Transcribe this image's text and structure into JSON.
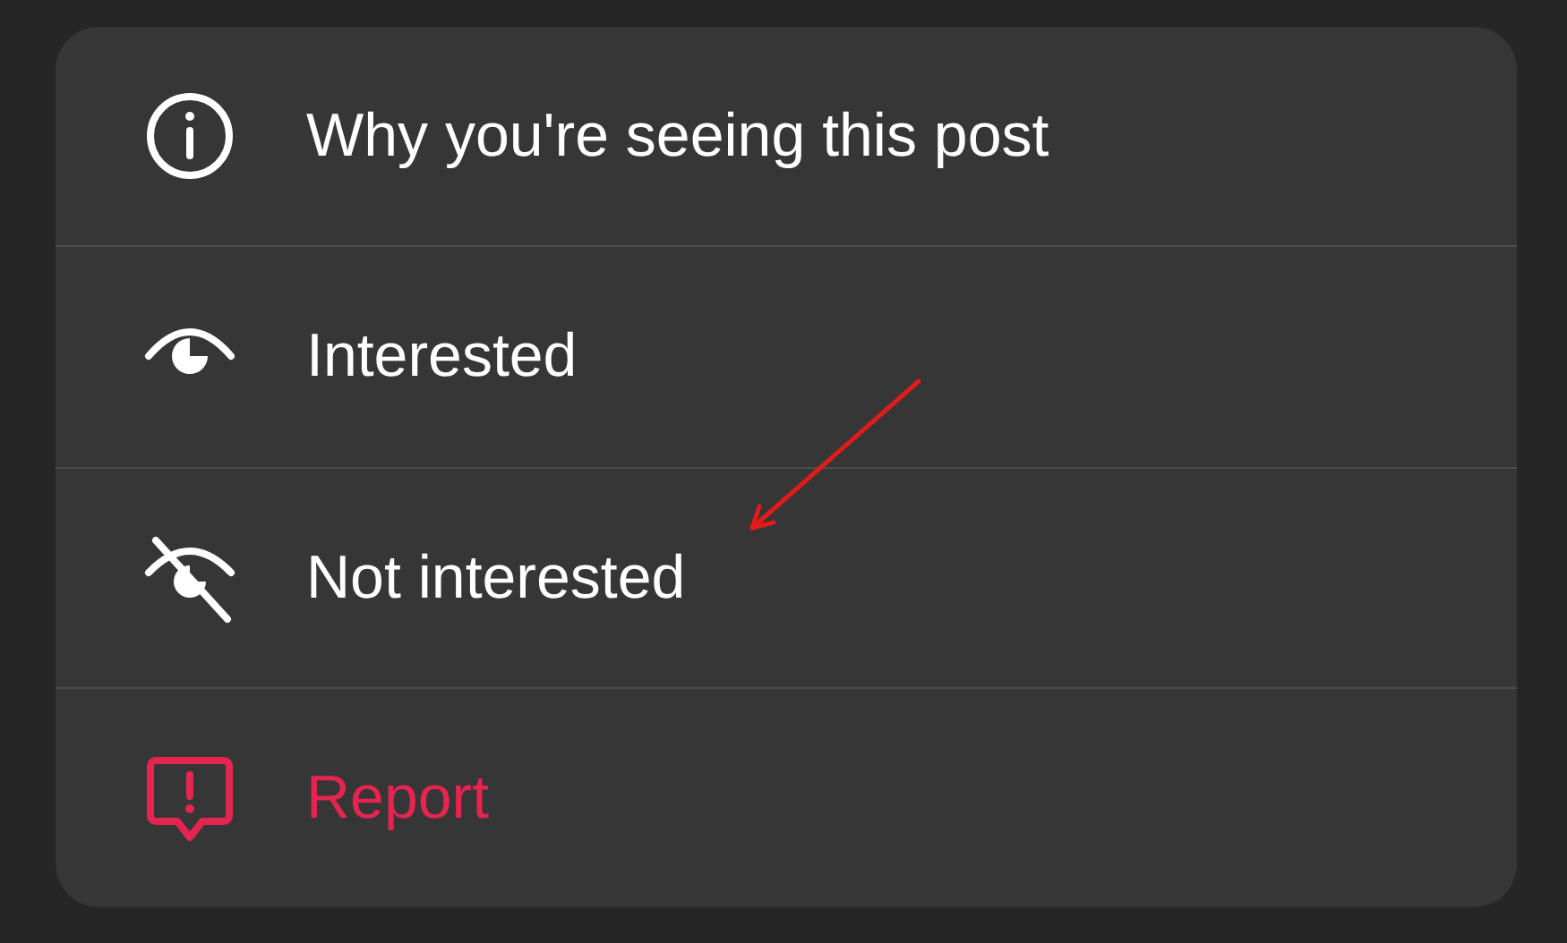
{
  "menu": {
    "items": [
      {
        "kind": "info",
        "label": "Why you're seeing this post",
        "color": "#ffffff"
      },
      {
        "kind": "eye",
        "label": "Interested",
        "color": "#ffffff"
      },
      {
        "kind": "eye-off",
        "label": "Not interested",
        "color": "#ffffff"
      },
      {
        "kind": "report",
        "label": "Report",
        "color": "#e5254f"
      }
    ]
  }
}
